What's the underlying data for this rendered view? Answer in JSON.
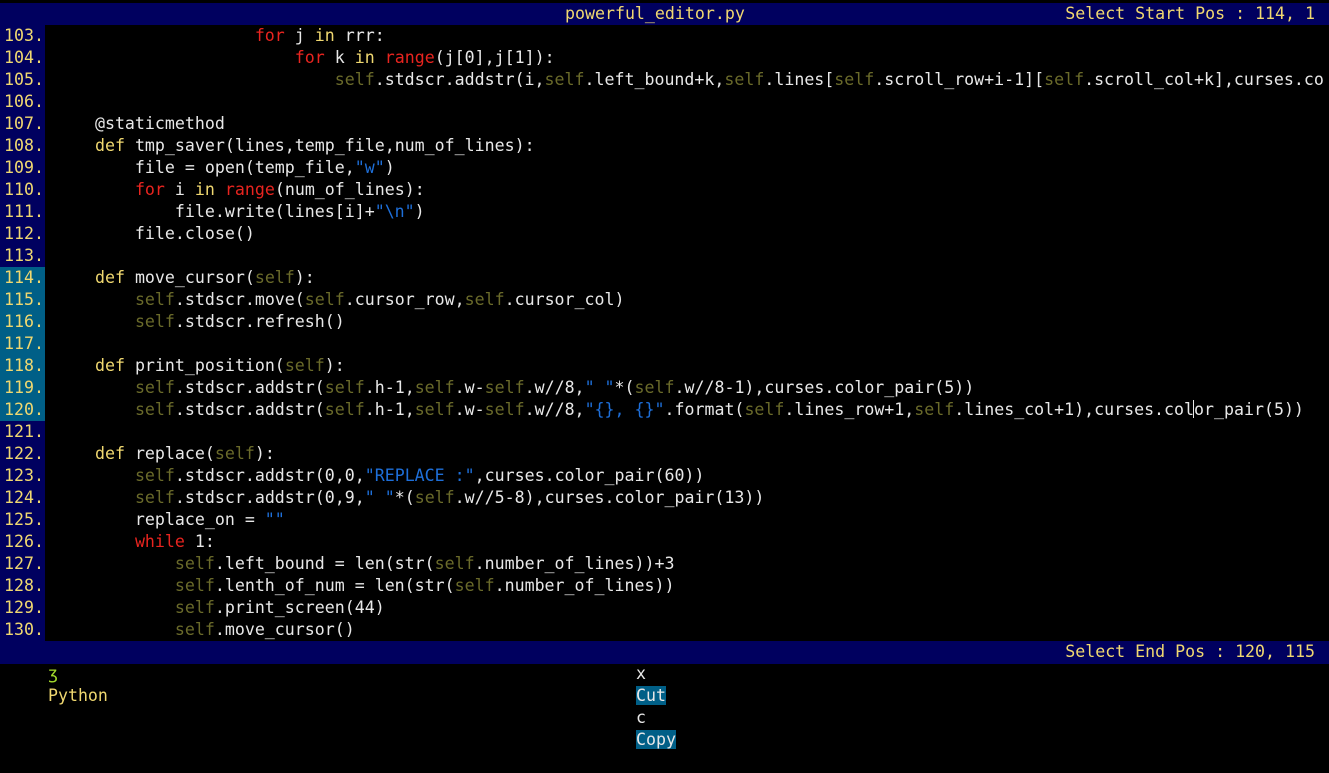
{
  "title_bar": {
    "filename": "powerful_editor.py",
    "select_start_label": "Select Start Pos : 114, 1"
  },
  "editor": {
    "selection_lines": [
      114,
      115,
      116,
      117,
      118,
      119,
      120
    ],
    "lines": [
      {
        "num": "103.",
        "tokens": [
          [
            "",
            "                    "
          ],
          [
            "kw-r",
            "for"
          ],
          [
            "",
            " j "
          ],
          [
            "kw-y",
            "in"
          ],
          [
            "",
            " rrr:"
          ]
        ]
      },
      {
        "num": "104.",
        "tokens": [
          [
            "",
            "                        "
          ],
          [
            "kw-r",
            "for"
          ],
          [
            "",
            " k "
          ],
          [
            "kw-y",
            "in"
          ],
          [
            "",
            " "
          ],
          [
            "kw-r",
            "range"
          ],
          [
            "",
            "(j[0],j[1]):"
          ]
        ]
      },
      {
        "num": "105.",
        "tokens": [
          [
            "",
            "                            "
          ],
          [
            "self",
            "self"
          ],
          [
            "",
            ".stdscr.addstr(i,"
          ],
          [
            "self",
            "self"
          ],
          [
            "",
            ".left_bound+k,"
          ],
          [
            "self",
            "self"
          ],
          [
            "",
            ".lines["
          ],
          [
            "self",
            "self"
          ],
          [
            "",
            ".scroll_row+i-1]["
          ],
          [
            "self",
            "self"
          ],
          [
            "",
            ".scroll_col+k],curses.co"
          ]
        ]
      },
      {
        "num": "106.",
        "tokens": []
      },
      {
        "num": "107.",
        "tokens": [
          [
            "",
            "    @staticmethod"
          ]
        ]
      },
      {
        "num": "108.",
        "tokens": [
          [
            "",
            "    "
          ],
          [
            "kw-y",
            "def"
          ],
          [
            "",
            " tmp_saver(lines,temp_file,num_of_lines):"
          ]
        ]
      },
      {
        "num": "109.",
        "tokens": [
          [
            "",
            "        file = open(temp_file,"
          ],
          [
            "str",
            "\"w\""
          ],
          [
            "",
            ")"
          ]
        ]
      },
      {
        "num": "110.",
        "tokens": [
          [
            "",
            "        "
          ],
          [
            "kw-r",
            "for"
          ],
          [
            "",
            " i "
          ],
          [
            "kw-y",
            "in"
          ],
          [
            "",
            " "
          ],
          [
            "kw-r",
            "range"
          ],
          [
            "",
            "(num_of_lines):"
          ]
        ]
      },
      {
        "num": "111.",
        "tokens": [
          [
            "",
            "            file.write(lines[i]+"
          ],
          [
            "str",
            "\"\\n\""
          ],
          [
            "",
            ")"
          ]
        ]
      },
      {
        "num": "112.",
        "tokens": [
          [
            "",
            "        file.close()"
          ]
        ]
      },
      {
        "num": "113.",
        "tokens": []
      },
      {
        "num": "114.",
        "tokens": [
          [
            "",
            "    "
          ],
          [
            "kw-y",
            "def"
          ],
          [
            "",
            " move_cursor("
          ],
          [
            "self",
            "self"
          ],
          [
            "",
            "):"
          ]
        ]
      },
      {
        "num": "115.",
        "tokens": [
          [
            "",
            "        "
          ],
          [
            "self",
            "self"
          ],
          [
            "",
            ".stdscr.move("
          ],
          [
            "self",
            "self"
          ],
          [
            "",
            ".cursor_row,"
          ],
          [
            "self",
            "self"
          ],
          [
            "",
            ".cursor_col)"
          ]
        ]
      },
      {
        "num": "116.",
        "tokens": [
          [
            "",
            "        "
          ],
          [
            "self",
            "self"
          ],
          [
            "",
            ".stdscr.refresh()"
          ]
        ]
      },
      {
        "num": "117.",
        "tokens": []
      },
      {
        "num": "118.",
        "tokens": [
          [
            "",
            "    "
          ],
          [
            "kw-y",
            "def"
          ],
          [
            "",
            " print_position("
          ],
          [
            "self",
            "self"
          ],
          [
            "",
            "):"
          ]
        ]
      },
      {
        "num": "119.",
        "tokens": [
          [
            "",
            "        "
          ],
          [
            "self",
            "self"
          ],
          [
            "",
            ".stdscr.addstr("
          ],
          [
            "self",
            "self"
          ],
          [
            "",
            ".h-1,"
          ],
          [
            "self",
            "self"
          ],
          [
            "",
            ".w-"
          ],
          [
            "self",
            "self"
          ],
          [
            "",
            ".w//8,"
          ],
          [
            "str",
            "\" \""
          ],
          [
            "",
            "*("
          ],
          [
            "self",
            "self"
          ],
          [
            "",
            ".w//8-1),curses.color_pair(5))"
          ]
        ]
      },
      {
        "num": "120.",
        "tokens": [
          [
            "",
            "        "
          ],
          [
            "self",
            "self"
          ],
          [
            "",
            ".stdscr.addstr("
          ],
          [
            "self",
            "self"
          ],
          [
            "",
            ".h-1,"
          ],
          [
            "self",
            "self"
          ],
          [
            "",
            ".w-"
          ],
          [
            "self",
            "self"
          ],
          [
            "",
            ".w//8,"
          ],
          [
            "str",
            "\"{}, {}\""
          ],
          [
            "",
            ".format("
          ],
          [
            "self",
            "self"
          ],
          [
            "",
            ".lines_row+1,"
          ],
          [
            "self",
            "self"
          ],
          [
            "",
            ".lines_col+1),curses.col"
          ],
          [
            "cursor",
            ""
          ],
          [
            "",
            "or_pair(5))"
          ]
        ]
      },
      {
        "num": "121.",
        "tokens": []
      },
      {
        "num": "122.",
        "tokens": [
          [
            "",
            "    "
          ],
          [
            "kw-y",
            "def"
          ],
          [
            "",
            " replace("
          ],
          [
            "self",
            "self"
          ],
          [
            "",
            "):"
          ]
        ]
      },
      {
        "num": "123.",
        "tokens": [
          [
            "",
            "        "
          ],
          [
            "self",
            "self"
          ],
          [
            "",
            ".stdscr.addstr(0,0,"
          ],
          [
            "str",
            "\"REPLACE :\""
          ],
          [
            "",
            ",curses.color_pair(60))"
          ]
        ]
      },
      {
        "num": "124.",
        "tokens": [
          [
            "",
            "        "
          ],
          [
            "self",
            "self"
          ],
          [
            "",
            ".stdscr.addstr(0,9,"
          ],
          [
            "str",
            "\" \""
          ],
          [
            "",
            "*("
          ],
          [
            "self",
            "self"
          ],
          [
            "",
            ".w//5-8),curses.color_pair(13))"
          ]
        ]
      },
      {
        "num": "125.",
        "tokens": [
          [
            "",
            "        replace_on = "
          ],
          [
            "str",
            "\"\""
          ]
        ]
      },
      {
        "num": "126.",
        "tokens": [
          [
            "",
            "        "
          ],
          [
            "kw-r",
            "while"
          ],
          [
            "",
            " 1:"
          ]
        ]
      },
      {
        "num": "127.",
        "tokens": [
          [
            "",
            "            "
          ],
          [
            "self",
            "self"
          ],
          [
            "",
            ".left_bound = len(str("
          ],
          [
            "self",
            "self"
          ],
          [
            "",
            ".number_of_lines))+3"
          ]
        ]
      },
      {
        "num": "128.",
        "tokens": [
          [
            "",
            "            "
          ],
          [
            "self",
            "self"
          ],
          [
            "",
            ".lenth_of_num = len(str("
          ],
          [
            "self",
            "self"
          ],
          [
            "",
            ".number_of_lines))"
          ]
        ]
      },
      {
        "num": "129.",
        "tokens": [
          [
            "",
            "            "
          ],
          [
            "self",
            "self"
          ],
          [
            "",
            ".print_screen(44)"
          ]
        ]
      },
      {
        "num": "130.",
        "tokens": [
          [
            "",
            "            "
          ],
          [
            "self",
            "self"
          ],
          [
            "",
            ".move_cursor()"
          ]
        ]
      }
    ]
  },
  "status_bar": {
    "language_icon": "python-snake-icon",
    "language": "Python",
    "shortcuts": [
      {
        "key": "x",
        "label": "Cut"
      },
      {
        "key": "c",
        "label": "Copy"
      }
    ],
    "select_end_label": "Select End Pos : 120, 115"
  },
  "colors": {
    "bar_bg": "#00005f",
    "selection_gutter_bg": "#005f87",
    "keyword_red": "#e8241f",
    "keyword_yellow": "#f0d870",
    "self_olive": "#6a6a2a",
    "string_blue": "#1e6fd9"
  }
}
